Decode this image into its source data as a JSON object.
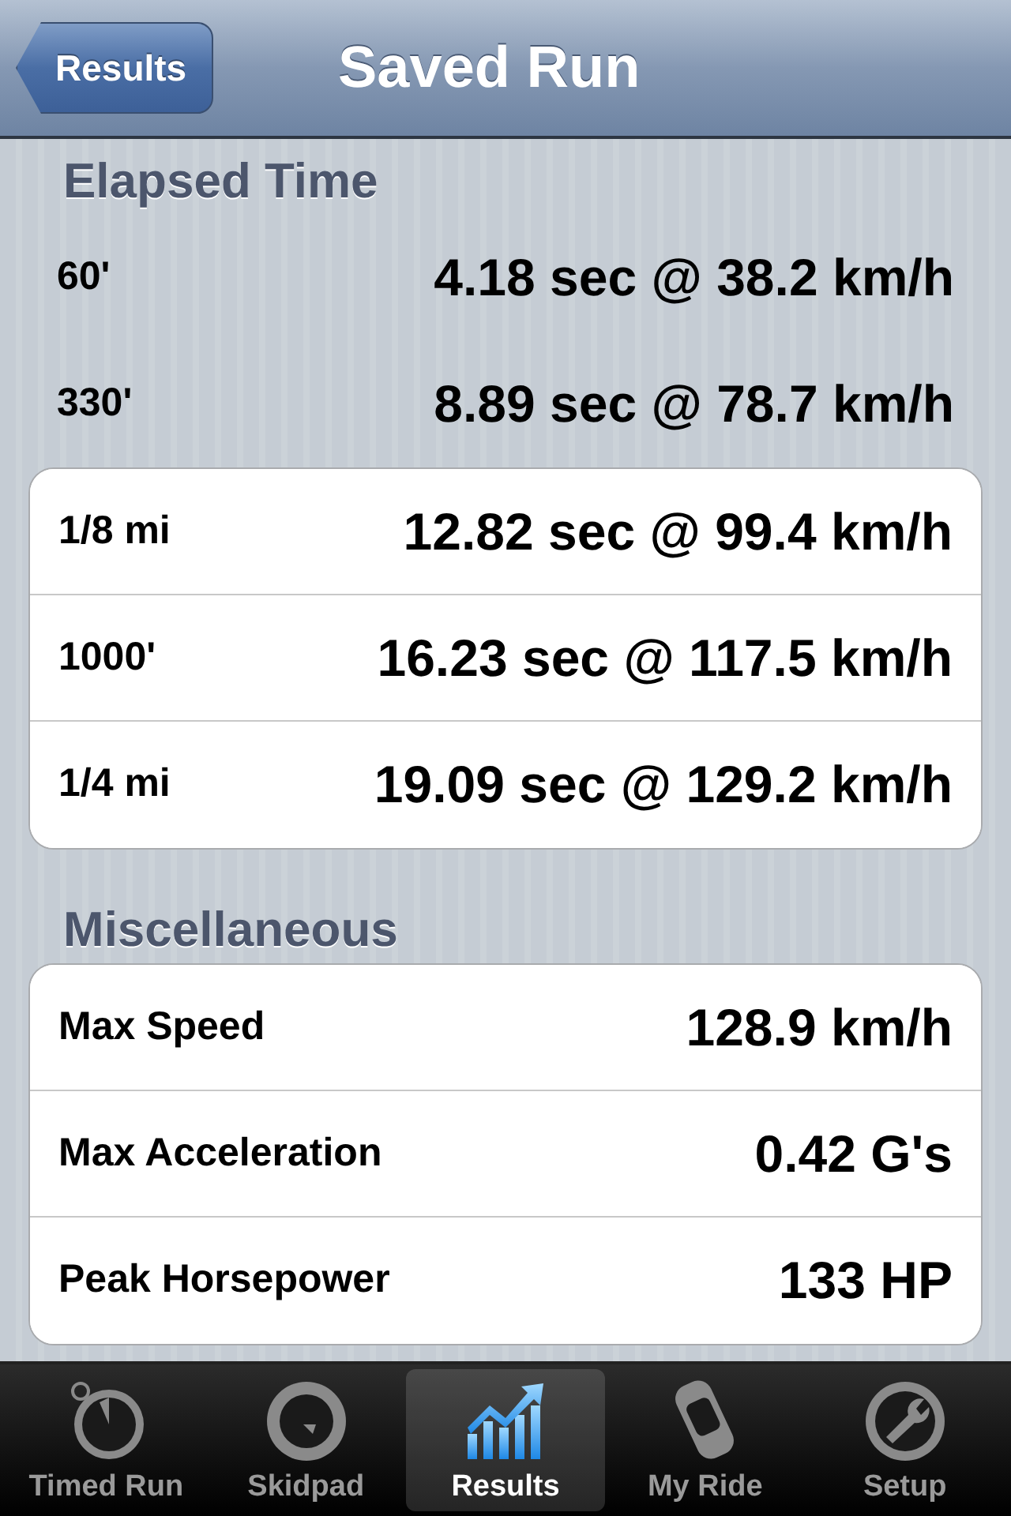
{
  "nav_bar": {
    "back_button": "Results",
    "title": "Saved Run"
  },
  "sections": [
    {
      "header": "Elapsed Time",
      "rows": [
        {
          "kind": "bare",
          "label": "60'",
          "value": "4.18 sec @ 38.2 km/h"
        },
        {
          "kind": "bare",
          "label": "330'",
          "value": "8.89 sec @ 78.7 km/h"
        },
        {
          "kind": "cell",
          "label": "1/8 mi",
          "value": "12.82 sec @ 99.4 km/h"
        },
        {
          "kind": "cell",
          "label": "1000'",
          "value": "16.23 sec @ 117.5 km/h"
        },
        {
          "kind": "cell",
          "label": "1/4 mi",
          "value": "19.09 sec @ 129.2 km/h"
        }
      ]
    },
    {
      "header": "Miscellaneous",
      "rows": [
        {
          "kind": "cell",
          "label": "Max Speed",
          "value": "128.9 km/h"
        },
        {
          "kind": "cell",
          "label": "Max Acceleration",
          "value": "0.42 G's"
        },
        {
          "kind": "cell",
          "label": "Peak Horsepower",
          "value": "133 HP"
        }
      ]
    }
  ],
  "tab_bar": [
    {
      "kind": "stopwatch",
      "label": "Timed Run",
      "selected": false
    },
    {
      "kind": "gauge",
      "label": "Skidpad",
      "selected": false
    },
    {
      "kind": "chart",
      "label": "Results",
      "selected": true
    },
    {
      "kind": "car",
      "label": "My Ride",
      "selected": false
    },
    {
      "kind": "wrench",
      "label": "Setup",
      "selected": false
    }
  ]
}
